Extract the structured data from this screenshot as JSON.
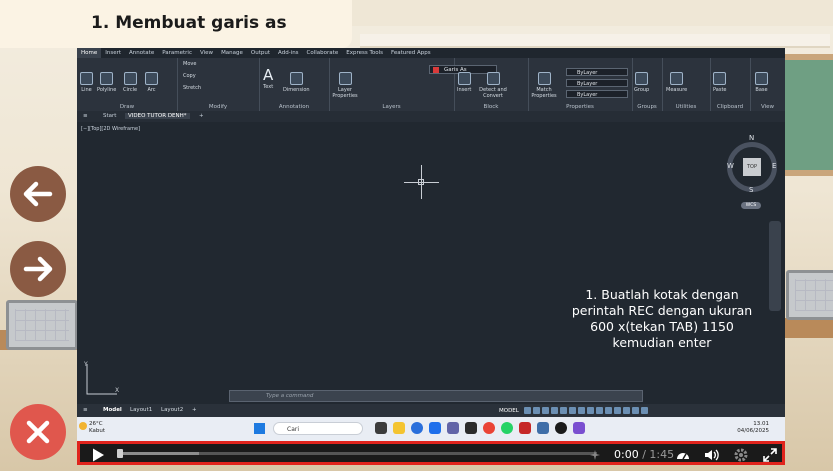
{
  "slide": {
    "title": "1. Membuat garis as"
  },
  "nav": {
    "back_icon": "arrow-left-icon",
    "next_icon": "arrow-right-icon",
    "close_icon": "close-icon"
  },
  "autocad": {
    "ribbon_tabs": [
      "Home",
      "Insert",
      "Annotate",
      "Parametric",
      "View",
      "Manage",
      "Output",
      "Add-ins",
      "Collaborate",
      "Express Tools",
      "Featured Apps"
    ],
    "draw_tools": [
      "Line",
      "Polyline",
      "Circle",
      "Arc"
    ],
    "modify_tools": [
      "Move",
      "Copy",
      "Stretch"
    ],
    "annotation_tools": [
      "Text",
      "Dimension"
    ],
    "layer_tool": "Layer Properties",
    "layer_current": "Garis As",
    "block_tools": [
      "Insert",
      "Detect and Convert"
    ],
    "match_tool": "Match Properties",
    "prop_values": [
      "ByLayer",
      "ByLayer",
      "ByLayer"
    ],
    "group_tool": "Group",
    "measure_tool": "Measure",
    "paste_tool": "Paste",
    "base_tool": "Base",
    "groups": [
      "Draw",
      "Modify",
      "Annotation",
      "Layers",
      "Block",
      "Properties",
      "Groups",
      "Utilities",
      "Clipboard",
      "View"
    ],
    "doc_tabs": [
      "Start",
      "VIDEO TUTOR DENH*"
    ],
    "viewport_label": "[−][Top][2D Wireframe]",
    "viewcube": {
      "top": "TOP",
      "n": "N",
      "s": "S",
      "e": "E",
      "w": "W",
      "wcs": "WCS"
    },
    "ucs": {
      "x": "X",
      "y": "Y"
    },
    "command_placeholder": "Type a command",
    "layout_tabs": [
      "Model",
      "Layout1",
      "Layout2"
    ],
    "status_model": "MODEL"
  },
  "instruction_lines": [
    "1. Buatlah kotak dengan",
    "perintah REC dengan ukuran",
    "600 x(tekan TAB) 1150",
    "kemudian enter"
  ],
  "taskbar": {
    "temperature": "26°C",
    "weather": "Kabut",
    "search_placeholder": "Cari",
    "time": "13.01",
    "date": "04/06/2025"
  },
  "player": {
    "current_time": "0:00",
    "separator": "/",
    "total_time": "1:45",
    "progress_fraction": 0.0,
    "buffer_fraction": 0.17,
    "colors": {
      "border": "#e0241d",
      "bar": "#1a1a1a"
    }
  }
}
